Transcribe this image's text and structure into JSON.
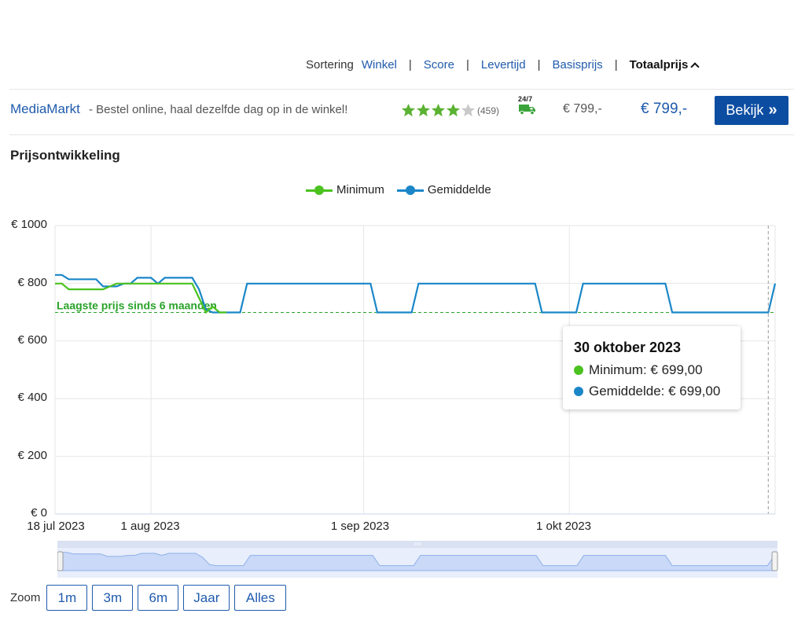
{
  "sort": {
    "label": "Sortering",
    "options": [
      "Winkel",
      "Score",
      "Levertijd",
      "Basisprijs"
    ],
    "active": "Totaalprijs",
    "separator": "|"
  },
  "offer": {
    "shop_name": "MediaMarkt",
    "description": " - Bestel online, haal dezelfde dag op in de winkel!",
    "rating_stars": 4,
    "rating_max": 5,
    "review_count": "(459)",
    "delivery_badge": "24/7",
    "base_price": "€ 799,-",
    "total_price": "€ 799,-",
    "button_label": "Bekijk",
    "button_arrow": "»"
  },
  "section_title": "Prijsontwikkeling",
  "colors": {
    "minimum": "#4bc21f",
    "average": "#1a86c8",
    "link": "#1f5bad",
    "button": "#0c4da2",
    "star": "#5ab232"
  },
  "chart_data": {
    "type": "line",
    "legend": [
      "Minimum",
      "Gemiddelde"
    ],
    "legend_position": "top-center",
    "grid": true,
    "y_ticks": [
      "€ 1000",
      "€ 800",
      "€ 600",
      "€ 400",
      "€ 200",
      "€ 0"
    ],
    "ylim": [
      0,
      1000
    ],
    "x_ticks": [
      "18 jul 2023",
      "1 aug 2023",
      "1 sep 2023",
      "1 okt 2023"
    ],
    "xlim": [
      "2023-07-18",
      "2023-10-31"
    ],
    "annotation": "Laagste prijs sinds 6 maanden",
    "annotation_value": 699,
    "series": [
      {
        "name": "Minimum",
        "points": [
          [
            "2023-07-18",
            799
          ],
          [
            "2023-07-19",
            799
          ],
          [
            "2023-07-20",
            779
          ],
          [
            "2023-07-21",
            779
          ],
          [
            "2023-07-25",
            779
          ],
          [
            "2023-07-26",
            789
          ],
          [
            "2023-07-27",
            799
          ],
          [
            "2023-08-02",
            799
          ],
          [
            "2023-08-07",
            799
          ],
          [
            "2023-08-08",
            749
          ],
          [
            "2023-08-09",
            699
          ],
          [
            "2023-08-10",
            719
          ],
          [
            "2023-08-11",
            699
          ],
          [
            "2023-08-12",
            699
          ]
        ]
      },
      {
        "name": "Gemiddelde",
        "points": [
          [
            "2023-07-18",
            829
          ],
          [
            "2023-07-19",
            829
          ],
          [
            "2023-07-20",
            814
          ],
          [
            "2023-07-22",
            814
          ],
          [
            "2023-07-24",
            814
          ],
          [
            "2023-07-25",
            789
          ],
          [
            "2023-07-27",
            789
          ],
          [
            "2023-07-28",
            799
          ],
          [
            "2023-07-29",
            799
          ],
          [
            "2023-07-30",
            819
          ],
          [
            "2023-08-01",
            819
          ],
          [
            "2023-08-02",
            799
          ],
          [
            "2023-08-03",
            819
          ],
          [
            "2023-08-07",
            819
          ],
          [
            "2023-08-08",
            779
          ],
          [
            "2023-08-09",
            709
          ],
          [
            "2023-08-10",
            699
          ],
          [
            "2023-08-14",
            699
          ],
          [
            "2023-08-15",
            799
          ],
          [
            "2023-09-02",
            799
          ],
          [
            "2023-09-03",
            699
          ],
          [
            "2023-09-08",
            699
          ],
          [
            "2023-09-09",
            799
          ],
          [
            "2023-09-26",
            799
          ],
          [
            "2023-09-27",
            699
          ],
          [
            "2023-10-02",
            699
          ],
          [
            "2023-10-03",
            799
          ],
          [
            "2023-10-15",
            799
          ],
          [
            "2023-10-16",
            699
          ],
          [
            "2023-10-30",
            699
          ],
          [
            "2023-10-31",
            799
          ]
        ]
      }
    ],
    "tooltip": {
      "date": "30 oktober 2023",
      "rows": [
        {
          "name": "Minimum",
          "value": "€ 699,00"
        },
        {
          "name": "Gemiddelde",
          "value": "€ 699,00"
        }
      ]
    }
  },
  "zoom": {
    "label": "Zoom",
    "buttons": [
      "1m",
      "3m",
      "6m",
      "Jaar",
      "Alles"
    ]
  }
}
